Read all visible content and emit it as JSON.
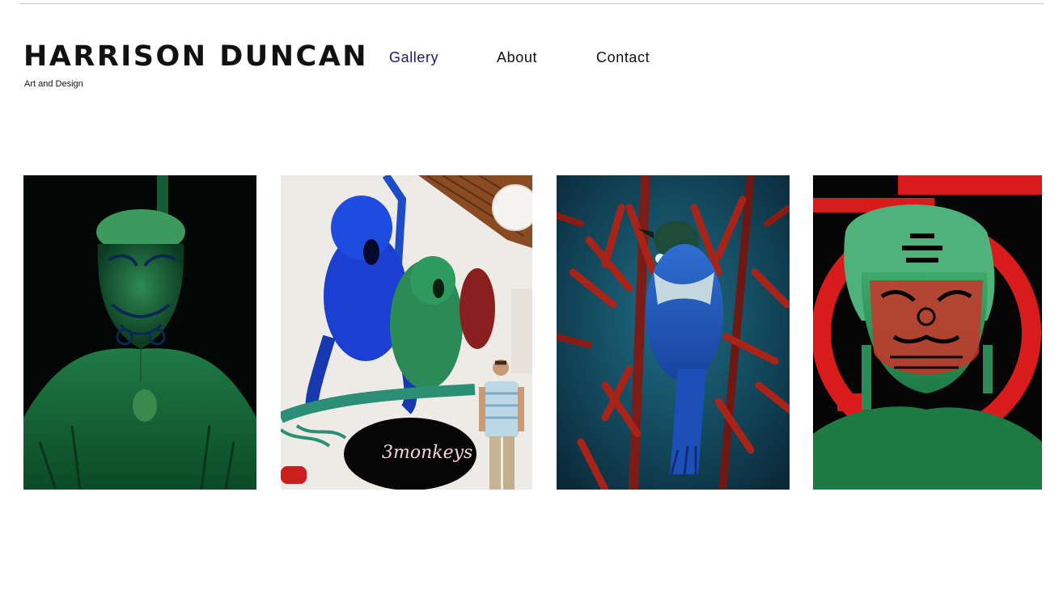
{
  "site": {
    "title": "HARRISON DUNCAN",
    "tagline": "Art and Design"
  },
  "nav": {
    "items": [
      {
        "label": "Gallery",
        "active": true
      },
      {
        "label": "About",
        "active": false
      },
      {
        "label": "Contact",
        "active": false
      }
    ]
  },
  "gallery": {
    "items": [
      {
        "subject": "green portrait of a Maori elder with moko and pounamu pendant"
      },
      {
        "subject": "mural of three monkeys with an artist standing beside it",
        "sign_text": "3monkeys"
      },
      {
        "subject": "tui bird perched among red flax flowers"
      },
      {
        "subject": "green and red portrait of a Maori woman with moko"
      }
    ]
  },
  "colors": {
    "nav_active": "#1a1a6e",
    "text": "#111111",
    "rule": "#c8c8c8"
  }
}
